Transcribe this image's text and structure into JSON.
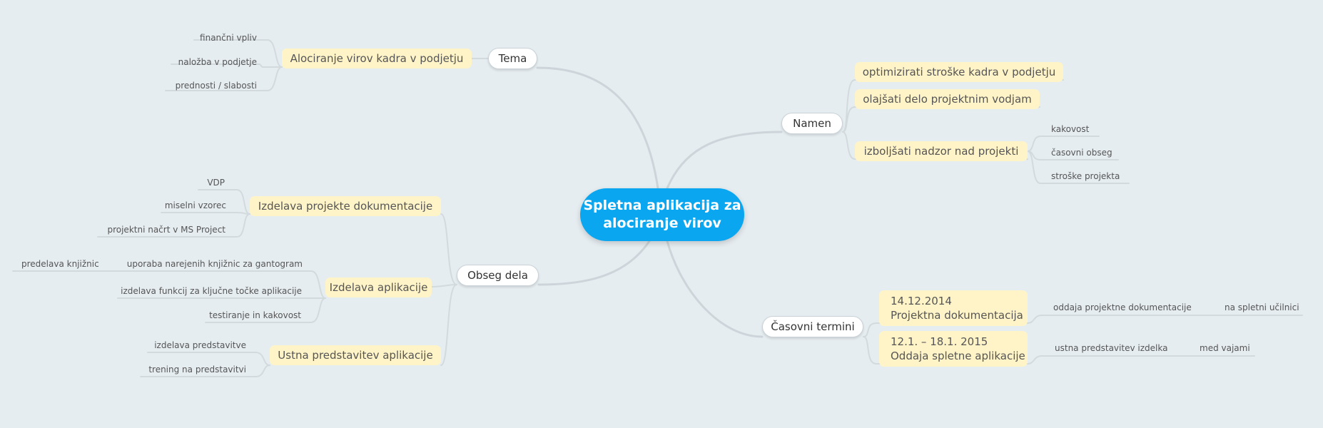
{
  "root": {
    "line1": "Spletna aplikacija za",
    "line2": "alociranje virov"
  },
  "branches": {
    "tema": {
      "label": "Tema",
      "sub": "Alociranje virov kadra v podjetju",
      "leaves": [
        "finančni vpliv",
        "naložba v podjetje",
        "prednosti / slabosti"
      ]
    },
    "namen": {
      "label": "Namen",
      "subs": [
        "optimizirati stroške kadra v podjetju",
        "olajšati delo projektnim vodjam",
        "izboljšati nadzor nad projekti"
      ],
      "leaves": [
        "kakovost",
        "časovni obseg",
        "stroške projekta"
      ]
    },
    "obseg": {
      "label": "Obseg dela",
      "doc": {
        "label": "Izdelava projekte dokumentacije",
        "leaves": [
          "VDP",
          "miselni vzorec",
          "projektni načrt v MS Project"
        ]
      },
      "app": {
        "label": "Izdelava aplikacije",
        "leaves": [
          "uporaba narejenih knjižnic za gantogram",
          "izdelava funkcij za ključne točke aplikacije",
          "testiranje in kakovost"
        ],
        "subleaf": "predelava knjižnic"
      },
      "pres": {
        "label": "Ustna predstavitev aplikacije",
        "leaves": [
          "izdelava predstavitve",
          "trening na predstavitvi"
        ]
      }
    },
    "termini": {
      "label": "Časovni termini",
      "items": [
        {
          "date": "14.12.2014",
          "title": "Projektna dokumentacija",
          "leaf": "oddaja projektne dokumentacije",
          "subleaf": "na spletni učilnici"
        },
        {
          "date": "12.1. – 18.1. 2015",
          "title": "Oddaja spletne aplikacije",
          "leaf": "ustna predstavitev izdelka",
          "subleaf": "med vajami"
        }
      ]
    }
  }
}
